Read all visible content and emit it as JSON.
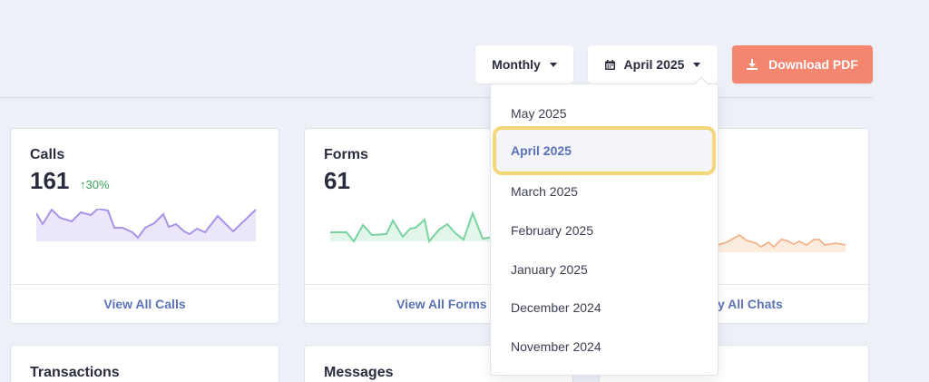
{
  "toolbar": {
    "period_label": "Monthly",
    "month_label": "April 2025",
    "download_label": "Download PDF"
  },
  "cards": {
    "calls": {
      "title": "Calls",
      "value": "161",
      "delta": "↑30%",
      "link": "View All Calls"
    },
    "forms": {
      "title": "Forms",
      "value": "61",
      "link": "View All Forms"
    },
    "chats": {
      "link_partial": "y All Chats"
    },
    "transactions": {
      "title": "Transactions"
    },
    "messages": {
      "title": "Messages"
    }
  },
  "dropdown": {
    "items": [
      "May 2025",
      "April 2025",
      "March 2025",
      "February 2025",
      "January 2025",
      "December 2024",
      "November 2024"
    ],
    "selected": "April 2025"
  },
  "colors": {
    "accent": "#5a73b7",
    "pdf_button": "#f48670",
    "calls_spark": "#a993e6",
    "forms_spark": "#79d3a0",
    "chats_spark": "#f3b48c",
    "highlight": "#f4d77a"
  }
}
